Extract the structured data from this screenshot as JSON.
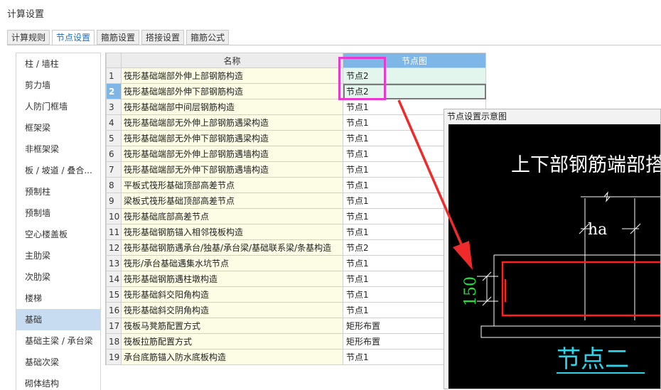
{
  "window": {
    "title": "计算设置"
  },
  "tabs": [
    {
      "label": "计算规则",
      "active": false
    },
    {
      "label": "节点设置",
      "active": true
    },
    {
      "label": "箍筋设置",
      "active": false
    },
    {
      "label": "搭接设置",
      "active": false
    },
    {
      "label": "箍筋公式",
      "active": false
    }
  ],
  "sidebar": {
    "selected": "基础",
    "items": [
      {
        "label": "柱 / 墙柱"
      },
      {
        "label": "剪力墙"
      },
      {
        "label": "人防门框墙"
      },
      {
        "label": "框架梁"
      },
      {
        "label": "非框架梁"
      },
      {
        "label": "板 / 坡道 / 叠合..."
      },
      {
        "label": "预制柱"
      },
      {
        "label": "预制墙"
      },
      {
        "label": "空心楼盖板"
      },
      {
        "label": "主肋梁"
      },
      {
        "label": "次肋梁"
      },
      {
        "label": "楼梯"
      },
      {
        "label": "基础"
      },
      {
        "label": "基础主梁 / 承台梁"
      },
      {
        "label": "基础次梁"
      },
      {
        "label": "砌体结构"
      }
    ]
  },
  "table": {
    "columns": {
      "name": "名称",
      "node": "节点图"
    },
    "selected_row": "2",
    "rows": [
      {
        "num": "1",
        "name": "筏形基础端部外伸上部钢筋构造",
        "node": "节点2"
      },
      {
        "num": "2",
        "name": "筏形基础端部外伸下部钢筋构造",
        "node": "节点2"
      },
      {
        "num": "3",
        "name": "筏形基础端部中间层钢筋构造",
        "node": "节点1"
      },
      {
        "num": "4",
        "name": "筏形基础端部无外伸上部钢筋遇梁构造",
        "node": "节点1"
      },
      {
        "num": "5",
        "name": "筏形基础端部无外伸下部钢筋遇梁构造",
        "node": "节点1"
      },
      {
        "num": "6",
        "name": "筏形基础端部无外伸上部钢筋遇墙构造",
        "node": "节点1"
      },
      {
        "num": "7",
        "name": "筏形基础端部无外伸下部钢筋遇墙构造",
        "node": "节点1"
      },
      {
        "num": "8",
        "name": "平板式筏形基础顶部高差节点",
        "node": "节点1"
      },
      {
        "num": "9",
        "name": "梁板式筏形基础顶部高差节点",
        "node": "节点1"
      },
      {
        "num": "10",
        "name": "筏形基础底部高差节点",
        "node": "节点1"
      },
      {
        "num": "11",
        "name": "筏形基础钢筋锚入相邻筏板构造",
        "node": "节点1"
      },
      {
        "num": "12",
        "name": "筏形基础钢筋遇承台/独基/承台梁/基础联系梁/条基构造",
        "node": "节点2"
      },
      {
        "num": "13",
        "name": "筏形/承台基础遇集水坑节点",
        "node": "节点1"
      },
      {
        "num": "14",
        "name": "筏形基础钢筋遇柱墩构造",
        "node": "节点1"
      },
      {
        "num": "15",
        "name": "筏形基础斜交阳角构造",
        "node": "节点1"
      },
      {
        "num": "16",
        "name": "筏形基础斜交阴角构造",
        "node": "节点1"
      },
      {
        "num": "17",
        "name": "筏板马凳筋配置方式",
        "node": "矩形布置"
      },
      {
        "num": "18",
        "name": "筏板拉筋配置方式",
        "node": "矩形布置"
      },
      {
        "num": "19",
        "name": "承台底筋锚入防水底板构造",
        "node": "节点1"
      }
    ]
  },
  "preview": {
    "title": "节点设置示意图",
    "heading": "上下部钢筋端部搭",
    "dim_ha": "ha",
    "dim_150": "150",
    "caption": "节点二",
    "colors": {
      "green": "#22e03a",
      "red": "#ff2020",
      "cyan": "#2ed3e8",
      "annotation": "#e83ad0",
      "arrow": "#ee2a2a"
    }
  }
}
